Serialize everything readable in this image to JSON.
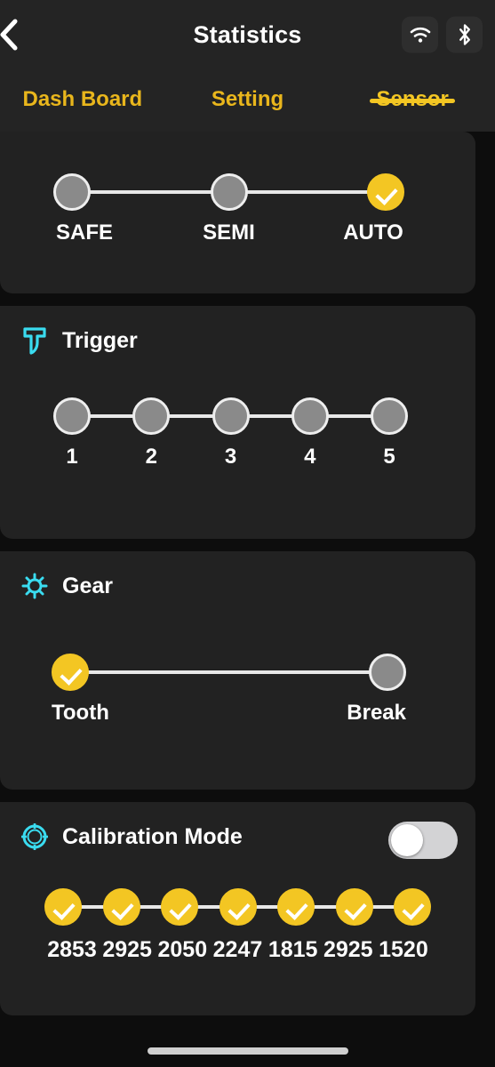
{
  "navbar": {
    "title": "Statistics",
    "back_icon": "chevron-left-icon",
    "status_icons": [
      {
        "name": "wifi-icon",
        "label": "WiFi"
      },
      {
        "name": "bluetooth-icon",
        "label": "Bluetooth"
      }
    ]
  },
  "tabs": [
    {
      "label": "Dash Board",
      "active": false
    },
    {
      "label": "Setting",
      "active": false
    },
    {
      "label": "Sensor",
      "active": true
    }
  ],
  "fire_mode": {
    "options": [
      {
        "label": "SAFE",
        "selected": false
      },
      {
        "label": "SEMI",
        "selected": false
      },
      {
        "label": "AUTO",
        "selected": true
      }
    ]
  },
  "trigger": {
    "title": "Trigger",
    "icon": "trigger-icon",
    "icon_color": "#3adcf0",
    "options": [
      {
        "label": "1",
        "selected": false
      },
      {
        "label": "2",
        "selected": false
      },
      {
        "label": "3",
        "selected": false
      },
      {
        "label": "4",
        "selected": false
      },
      {
        "label": "5",
        "selected": false
      }
    ]
  },
  "gear": {
    "title": "Gear",
    "icon": "gear-icon",
    "icon_color": "#3adcf0",
    "options": [
      {
        "label": "Tooth",
        "selected": true
      },
      {
        "label": "Break",
        "selected": false
      }
    ]
  },
  "calibration": {
    "title": "Calibration Mode",
    "icon": "calibration-target-icon",
    "icon_color": "#3adcf0",
    "toggle_on": false,
    "values": [
      {
        "label": "2853",
        "selected": true
      },
      {
        "label": "2925",
        "selected": true
      },
      {
        "label": "2050",
        "selected": true
      },
      {
        "label": "2247",
        "selected": true
      },
      {
        "label": "1815",
        "selected": true
      },
      {
        "label": "2925",
        "selected": true
      },
      {
        "label": "1520",
        "selected": true
      }
    ]
  },
  "colors": {
    "accent_yellow": "#f3c623",
    "accent_cyan": "#3adcf0",
    "card_bg": "#222222",
    "page_bg": "#0d0d0d",
    "dot_off": "#8a8a8a"
  }
}
